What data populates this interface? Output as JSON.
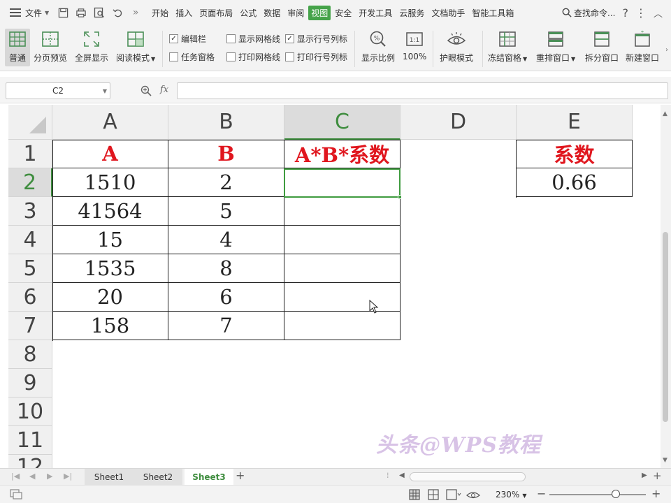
{
  "menubar": {
    "file": "文件",
    "tabs": [
      "开始",
      "插入",
      "页面布局",
      "公式",
      "数据",
      "审阅",
      "视图",
      "安全",
      "开发工具",
      "云服务",
      "文档助手",
      "智能工具箱"
    ],
    "active_tab": "视图",
    "search": "查找命令..."
  },
  "ribbon": {
    "normal": "普通",
    "page_break": "分页预览",
    "fullscreen": "全屏显示",
    "reading": "阅读模式",
    "cb_formula_bar": "编辑栏",
    "cb_task_pane": "任务窗格",
    "cb_show_grid": "显示网格线",
    "cb_print_grid": "打印网格线",
    "cb_show_headers": "显示行号列标",
    "cb_print_headers": "打印行号列标",
    "zoom_ratio": "显示比例",
    "zoom_100": "100%",
    "eye_mode": "护眼模式",
    "freeze": "冻结窗格",
    "arrange": "重排窗口",
    "split": "拆分窗口",
    "new_window": "新建窗口",
    "icon_100": "1:1",
    "icon_percent": "%"
  },
  "formula_bar": {
    "name_box": "C2",
    "fx": "fx",
    "content": ""
  },
  "grid": {
    "columns": [
      "A",
      "B",
      "C",
      "D",
      "E"
    ],
    "rows": [
      "1",
      "2",
      "3",
      "4",
      "5",
      "6",
      "7",
      "8",
      "9",
      "10",
      "11",
      "12"
    ],
    "header_row": {
      "A": "A",
      "B": "B",
      "C": "A*B*系数"
    },
    "data": [
      {
        "A": "1510",
        "B": "2",
        "C": ""
      },
      {
        "A": "41564",
        "B": "5",
        "C": ""
      },
      {
        "A": "15",
        "B": "4",
        "C": ""
      },
      {
        "A": "1535",
        "B": "8",
        "C": ""
      },
      {
        "A": "20",
        "B": "6",
        "C": ""
      },
      {
        "A": "158",
        "B": "7",
        "C": ""
      }
    ],
    "coef_label": "系数",
    "coef_value": "0.66",
    "selected_cell": "C2"
  },
  "sheets": {
    "tabs": [
      "Sheet1",
      "Sheet2",
      "Sheet3"
    ],
    "active": "Sheet3"
  },
  "status": {
    "zoom": "230%"
  },
  "watermark": "头条@WPS教程",
  "colors": {
    "accent_green": "#46a34a",
    "header_red": "#e0161e"
  }
}
